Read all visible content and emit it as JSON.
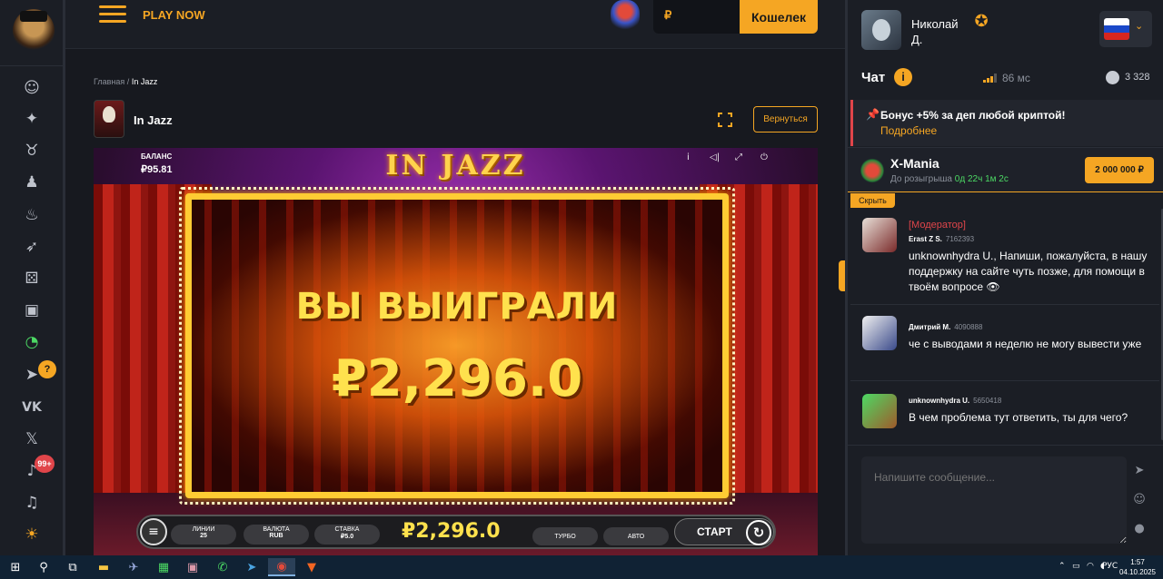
{
  "header": {
    "play_now": "PLAY NOW",
    "balance_currency": "₽",
    "wallet_button": "Кошелек"
  },
  "breadcrumb": {
    "home": "Главная",
    "separator": "/",
    "current": "In Jazz"
  },
  "game": {
    "title": "In Jazz",
    "back_button": "Вернуться",
    "logo_text": "IN JAZZ",
    "balance_label": "БАЛАНС",
    "balance_value": "₽95.81",
    "win_title": "ВЫ ВЫИГРАЛИ",
    "win_amount": "₽2,296.0",
    "controls": {
      "lines_label": "ЛИНИИ",
      "lines_value": "25",
      "currency_label": "ВАЛЮТА",
      "currency_value": "RUB",
      "bet_label": "СТАВКА",
      "bet_value": "₽5.0",
      "win_display": "₽2,296.0",
      "turbo": "ТУРБО",
      "auto": "АВТО",
      "start": "СТАРТ"
    },
    "top_icons": [
      "i",
      "◁|",
      "⤢",
      "⏻"
    ]
  },
  "user": {
    "name_line1": "Николай",
    "name_line2": "Д.",
    "language": "RU"
  },
  "chat": {
    "title": "Чат",
    "ping": "86 мс",
    "online": "3 328",
    "promo_text": "Бонус +5% за деп любой криптой!",
    "promo_link": "Подробнее",
    "raffle_title": "X-Mania",
    "raffle_sub_prefix": "До розыгрыша",
    "raffle_timer": "0д 22ч 1м 2с",
    "raffle_amount": "2 000 000 ₽",
    "hide_label": "Скрыть",
    "messages": [
      {
        "role": "[Модератор]",
        "author": "Erast Z S.",
        "uid": "7162393",
        "text": "unknownhydra U., Напиши, пожалуйста, в нашу поддержку на сайте чуть позже, для помощи в твоём вопросе 👁",
        "color": "#e0454a"
      },
      {
        "role": "",
        "author": "Дмитрий М.",
        "uid": "4090888",
        "text": "че с выводами я неделю не могу вывести уже",
        "color": "#ffffff"
      },
      {
        "role": "",
        "author": "unknownhydra U.",
        "uid": "5650418",
        "text": "В чем проблема тут ответить, ты для чего?",
        "color": "#ffffff"
      }
    ],
    "input_placeholder": "Напишите сообщение..."
  },
  "taskbar": {
    "tray_lang": "РУС",
    "time": "1:57",
    "date": "04.10.2025"
  },
  "colors": {
    "accent": "#f5a623",
    "bg": "#17191f",
    "panel": "#1b1e25",
    "moderator": "#e0454a",
    "timer": "#4cd964"
  }
}
